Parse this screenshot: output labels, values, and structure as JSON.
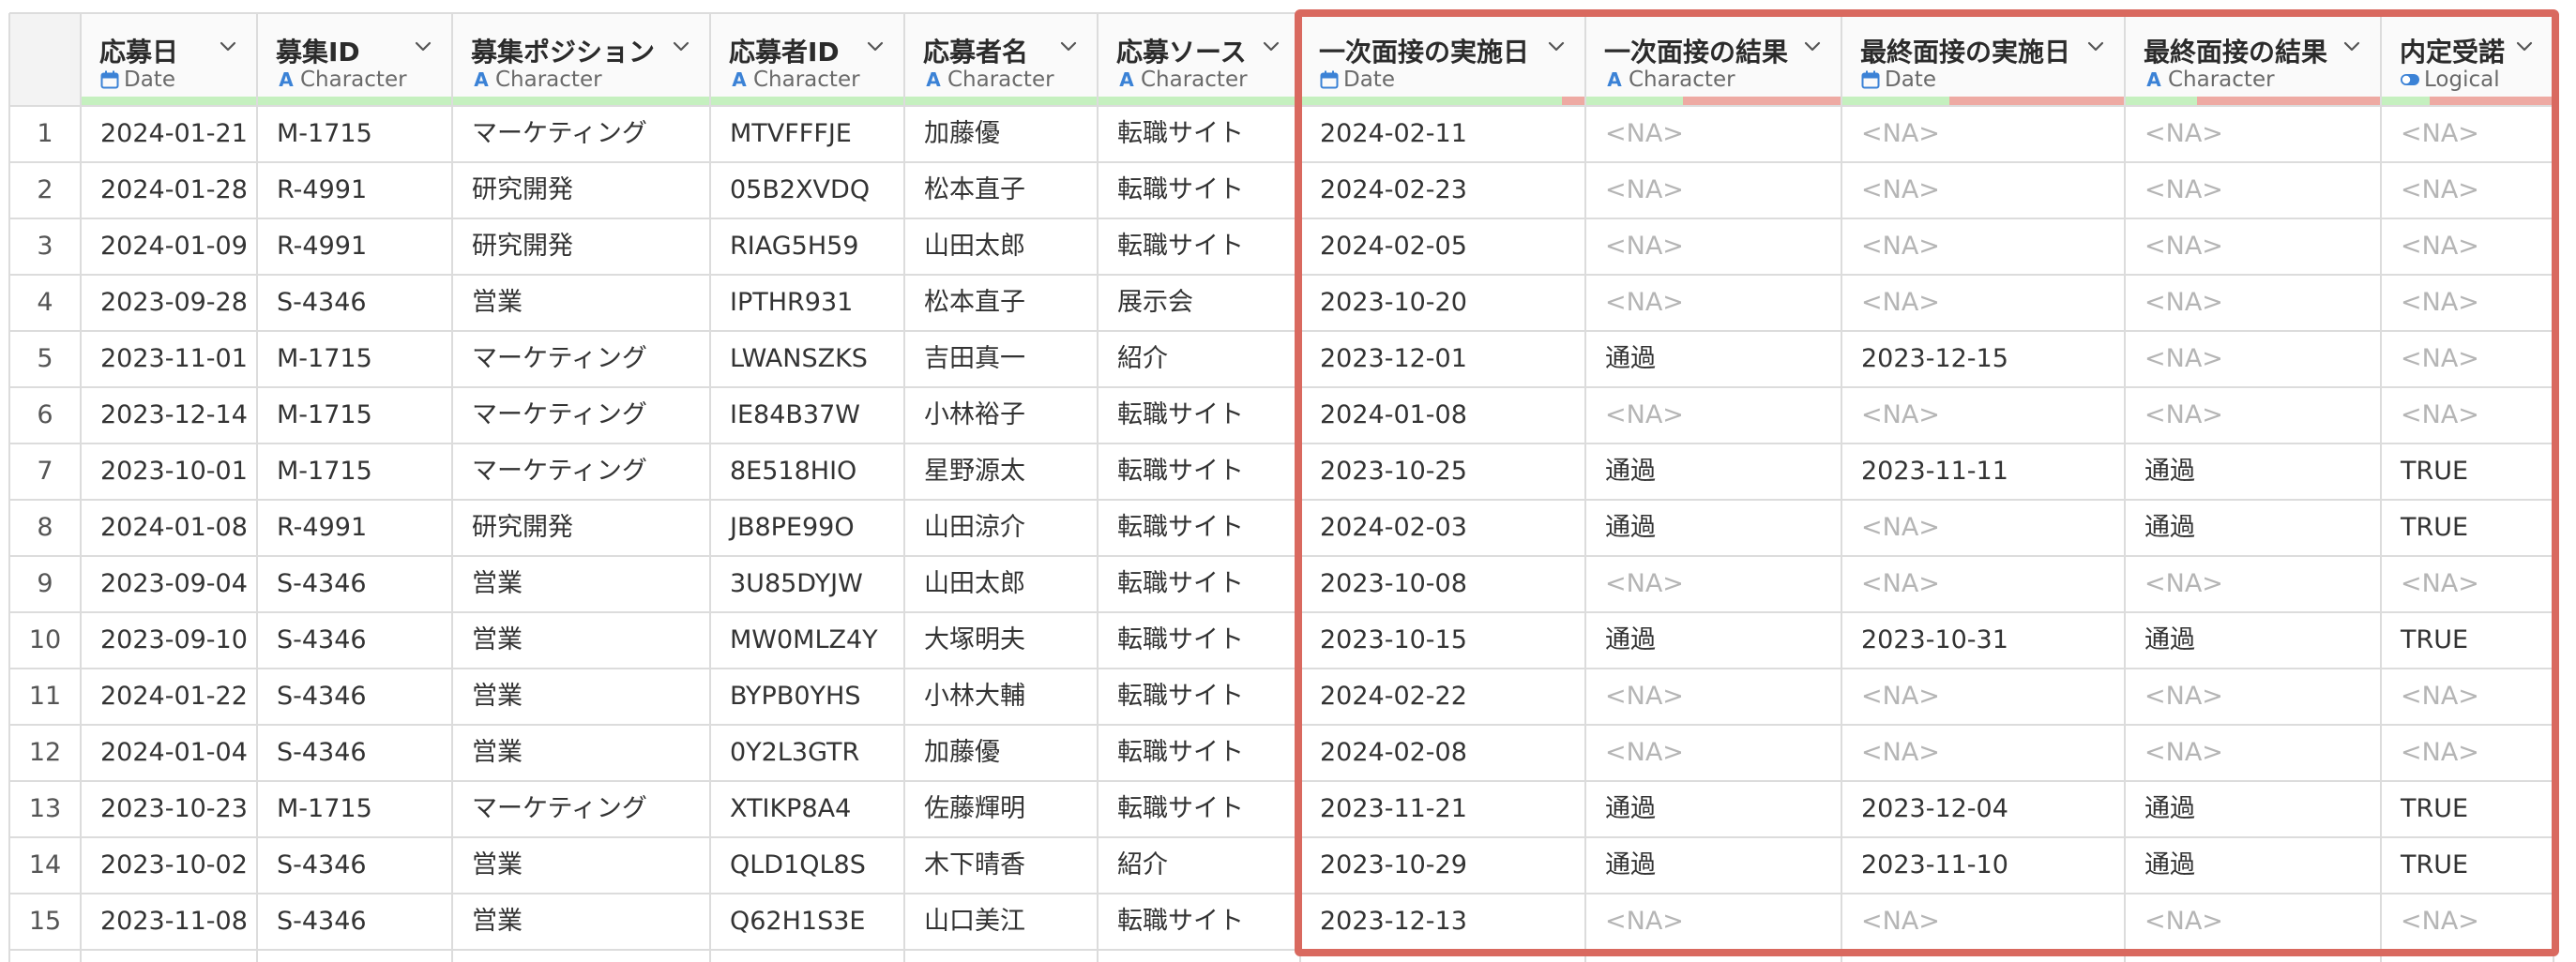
{
  "colors": {
    "highlight": "#d9695f",
    "valid": "#c5f0bf",
    "missing": "#eeaaa3",
    "typeIcon": "#3b82d6"
  },
  "columns": [
    {
      "title": "応募日",
      "type": "Date",
      "icon": "calendar-icon",
      "missing_fraction": 0
    },
    {
      "title": "募集ID",
      "type": "Character",
      "icon": "character-type-icon",
      "missing_fraction": 0
    },
    {
      "title": "募集ポジション",
      "type": "Character",
      "icon": "character-type-icon",
      "missing_fraction": 0
    },
    {
      "title": "応募者ID",
      "type": "Character",
      "icon": "character-type-icon",
      "missing_fraction": 0
    },
    {
      "title": "応募者名",
      "type": "Character",
      "icon": "character-type-icon",
      "missing_fraction": 0
    },
    {
      "title": "応募ソース",
      "type": "Character",
      "icon": "character-type-icon",
      "missing_fraction": 0
    },
    {
      "title": "一次面接の実施日",
      "type": "Date",
      "icon": "calendar-icon",
      "missing_fraction": 0.08
    },
    {
      "title": "一次面接の結果",
      "type": "Character",
      "icon": "character-type-icon",
      "missing_fraction": 0.62
    },
    {
      "title": "最終面接の実施日",
      "type": "Date",
      "icon": "calendar-icon",
      "missing_fraction": 0.62
    },
    {
      "title": "最終面接の結果",
      "type": "Character",
      "icon": "character-type-icon",
      "missing_fraction": 0.72
    },
    {
      "title": "内定受諾",
      "type": "Logical",
      "icon": "logical-type-icon",
      "missing_fraction": 0.72
    }
  ],
  "rows": [
    [
      "1",
      "2024-01-21",
      "M-1715",
      "マーケティング",
      "MTVFFFJE",
      "加藤優",
      "転職サイト",
      "2024-02-11",
      "<NA>",
      "<NA>",
      "<NA>",
      "<NA>"
    ],
    [
      "2",
      "2024-01-28",
      "R-4991",
      "研究開発",
      "05B2XVDQ",
      "松本直子",
      "転職サイト",
      "2024-02-23",
      "<NA>",
      "<NA>",
      "<NA>",
      "<NA>"
    ],
    [
      "3",
      "2024-01-09",
      "R-4991",
      "研究開発",
      "RIAG5H59",
      "山田太郎",
      "転職サイト",
      "2024-02-05",
      "<NA>",
      "<NA>",
      "<NA>",
      "<NA>"
    ],
    [
      "4",
      "2023-09-28",
      "S-4346",
      "営業",
      "IPTHR931",
      "松本直子",
      "展示会",
      "2023-10-20",
      "<NA>",
      "<NA>",
      "<NA>",
      "<NA>"
    ],
    [
      "5",
      "2023-11-01",
      "M-1715",
      "マーケティング",
      "LWANSZKS",
      "吉田真一",
      "紹介",
      "2023-12-01",
      "通過",
      "2023-12-15",
      "<NA>",
      "<NA>"
    ],
    [
      "6",
      "2023-12-14",
      "M-1715",
      "マーケティング",
      "IE84B37W",
      "小林裕子",
      "転職サイト",
      "2024-01-08",
      "<NA>",
      "<NA>",
      "<NA>",
      "<NA>"
    ],
    [
      "7",
      "2023-10-01",
      "M-1715",
      "マーケティング",
      "8E518HIO",
      "星野源太",
      "転職サイト",
      "2023-10-25",
      "通過",
      "2023-11-11",
      "通過",
      "TRUE"
    ],
    [
      "8",
      "2024-01-08",
      "R-4991",
      "研究開発",
      "JB8PE99O",
      "山田涼介",
      "転職サイト",
      "2024-02-03",
      "通過",
      "<NA>",
      "通過",
      "TRUE"
    ],
    [
      "9",
      "2023-09-04",
      "S-4346",
      "営業",
      "3U85DYJW",
      "山田太郎",
      "転職サイト",
      "2023-10-08",
      "<NA>",
      "<NA>",
      "<NA>",
      "<NA>"
    ],
    [
      "10",
      "2023-09-10",
      "S-4346",
      "営業",
      "MW0MLZ4Y",
      "大塚明夫",
      "転職サイト",
      "2023-10-15",
      "通過",
      "2023-10-31",
      "通過",
      "TRUE"
    ],
    [
      "11",
      "2024-01-22",
      "S-4346",
      "営業",
      "BYPB0YHS",
      "小林大輔",
      "転職サイト",
      "2024-02-22",
      "<NA>",
      "<NA>",
      "<NA>",
      "<NA>"
    ],
    [
      "12",
      "2024-01-04",
      "S-4346",
      "営業",
      "0Y2L3GTR",
      "加藤優",
      "転職サイト",
      "2024-02-08",
      "<NA>",
      "<NA>",
      "<NA>",
      "<NA>"
    ],
    [
      "13",
      "2023-10-23",
      "M-1715",
      "マーケティング",
      "XTIKP8A4",
      "佐藤輝明",
      "転職サイト",
      "2023-11-21",
      "通過",
      "2023-12-04",
      "通過",
      "TRUE"
    ],
    [
      "14",
      "2023-10-02",
      "S-4346",
      "営業",
      "QLD1QL8S",
      "木下晴香",
      "紹介",
      "2023-10-29",
      "通過",
      "2023-11-10",
      "通過",
      "TRUE"
    ],
    [
      "15",
      "2023-11-08",
      "S-4346",
      "営業",
      "Q62H1S3E",
      "山口美江",
      "転職サイト",
      "2023-12-13",
      "<NA>",
      "<NA>",
      "<NA>",
      "<NA>"
    ]
  ]
}
